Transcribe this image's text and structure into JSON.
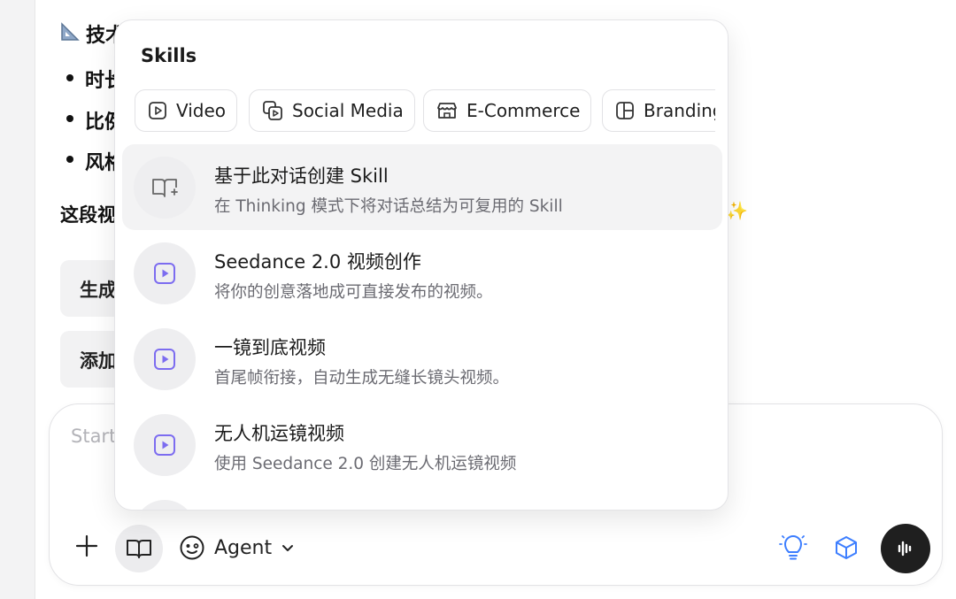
{
  "chat_background": {
    "heading_icon": "triangular-ruler-icon",
    "heading": "技术",
    "bullets": [
      "时长",
      "比例",
      "风格"
    ],
    "paragraph": "这段视",
    "suggestions": [
      "生成",
      "添加"
    ]
  },
  "composer": {
    "placeholder": "Start",
    "agent_label": "Agent",
    "icons": {
      "add": "plus-icon",
      "skills": "book-open-icon",
      "agent": "agent-face-icon",
      "dropdown": "chevron-down-icon",
      "ideas": "lightbulb-icon",
      "model": "cube-icon",
      "voice": "voice-wave-icon"
    }
  },
  "skills_popover": {
    "title": "Skills",
    "chips": [
      {
        "label": "Video",
        "icon": "play-square-icon"
      },
      {
        "label": "Social Media",
        "icon": "social-copy-icon"
      },
      {
        "label": "E-Commerce",
        "icon": "storefront-icon"
      },
      {
        "label": "Branding",
        "icon": "layout-grid-icon"
      }
    ],
    "items": [
      {
        "title": "基于此对话创建 Skill",
        "desc": "在 Thinking 模式下将对话总结为可复用的 Skill",
        "icon": "book-plus-icon"
      },
      {
        "title": "Seedance 2.0 视频创作",
        "desc": "将你的创意落地成可直接发布的视频。",
        "icon": "video-play-icon"
      },
      {
        "title": "一镜到底视频",
        "desc": "首尾帧衔接，自动生成无缝长镜头视频。",
        "icon": "video-play-icon"
      },
      {
        "title": "无人机运镜视频",
        "desc": "使用 Seedance 2.0 创建无人机运镜视频",
        "icon": "video-play-icon"
      }
    ]
  },
  "colors": {
    "accent_purple": "#7c6cf0",
    "accent_blue": "#3d7eff",
    "voice_button": "#1f1f1f"
  }
}
